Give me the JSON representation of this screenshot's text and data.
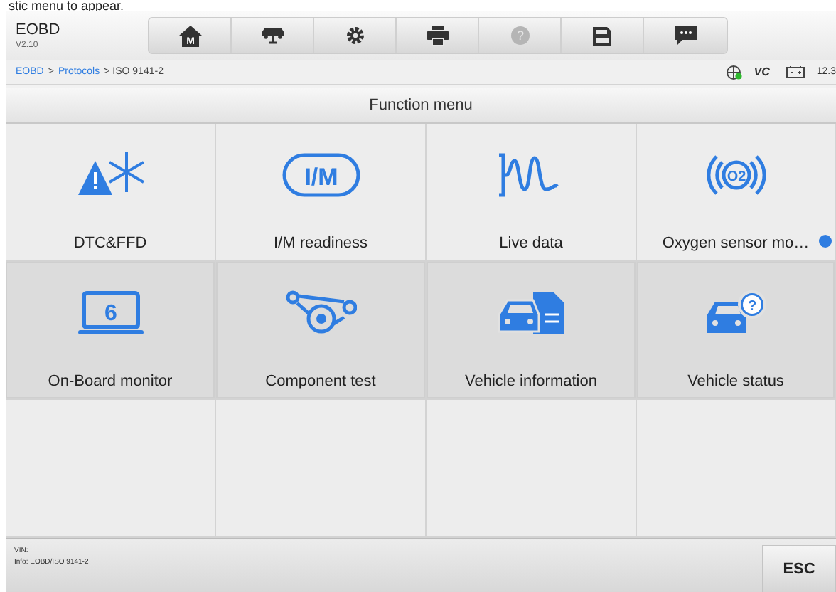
{
  "caption": "stic menu to appear.",
  "header": {
    "title": "EOBD",
    "version": "V2.10"
  },
  "toolbar": [
    {
      "kind": "home",
      "label": "M",
      "disabled": false
    },
    {
      "kind": "lift",
      "disabled": false
    },
    {
      "kind": "settings",
      "disabled": false
    },
    {
      "kind": "print",
      "disabled": false
    },
    {
      "kind": "help",
      "label": "?",
      "disabled": true
    },
    {
      "kind": "save",
      "disabled": false
    },
    {
      "kind": "chat",
      "disabled": false
    }
  ],
  "breadcrumb": [
    {
      "label": "EOBD",
      "link": true
    },
    {
      "label": ">",
      "link": false
    },
    {
      "label": "Protocols",
      "link": true
    },
    {
      "label": "> ISO 9141-2",
      "link": false
    }
  ],
  "status": {
    "vci_label": "VC",
    "battery": "12.3"
  },
  "menu": {
    "title": "Function menu",
    "items": [
      {
        "kind": "dtc",
        "label": "DTC&FFD",
        "highlighted": false,
        "info": false
      },
      {
        "kind": "im",
        "label": "I/M readiness",
        "icon_text": "I/M",
        "highlighted": false,
        "info": false
      },
      {
        "kind": "live",
        "label": "Live data",
        "highlighted": false,
        "info": false
      },
      {
        "kind": "o2",
        "label": "Oxygen sensor mo…",
        "icon_text": "O2",
        "highlighted": false,
        "info": true
      },
      {
        "kind": "obm",
        "label": "On-Board monitor",
        "icon_text": "6",
        "highlighted": true,
        "info": false
      },
      {
        "kind": "component",
        "label": "Component test",
        "highlighted": true,
        "info": false
      },
      {
        "kind": "vehinfo",
        "label": "Vehicle information",
        "highlighted": true,
        "info": false
      },
      {
        "kind": "vehstatus",
        "label": "Vehicle status",
        "icon_text": "?",
        "highlighted": true,
        "info": false
      },
      {
        "kind": "empty"
      },
      {
        "kind": "empty"
      },
      {
        "kind": "empty"
      },
      {
        "kind": "empty"
      }
    ]
  },
  "footer": {
    "vin": "VIN:",
    "info": "Info: EOBD/ISO 9141-2",
    "esc": "ESC"
  }
}
